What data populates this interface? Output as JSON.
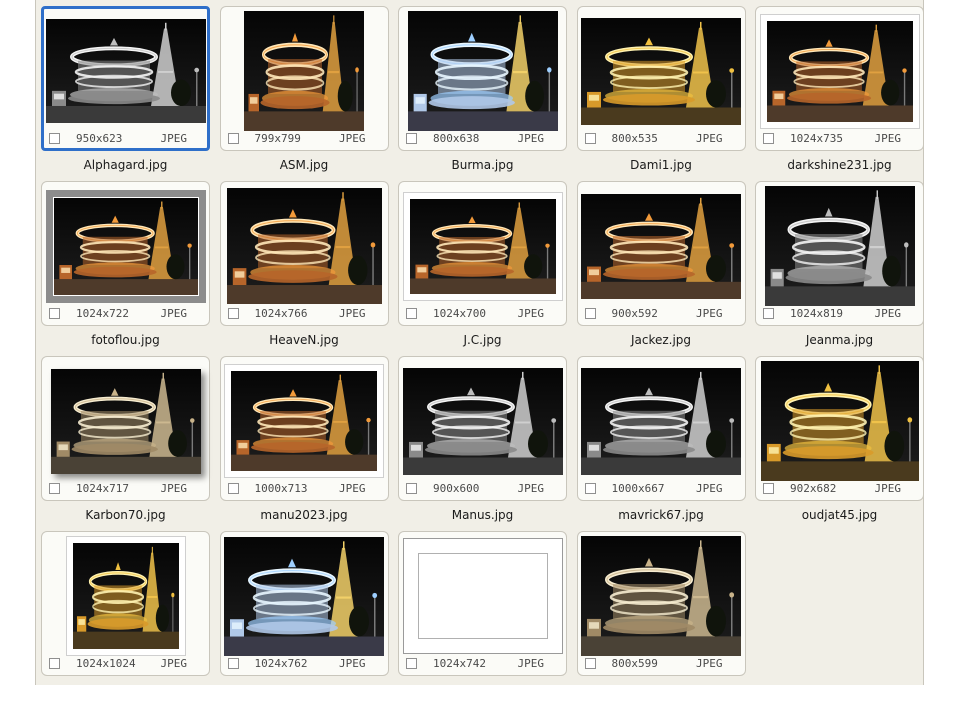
{
  "accent_color": "#2f6fc9",
  "items": [
    {
      "name": "Alphagard.jpg",
      "dims": "950x623",
      "type": "JPEG",
      "selected": true,
      "variant": "mono",
      "frame": "none",
      "tw": 160,
      "th": 104
    },
    {
      "name": "ASM.jpg",
      "dims": "799x799",
      "type": "JPEG",
      "selected": false,
      "variant": "warm",
      "frame": "none",
      "tw": 120,
      "th": 120
    },
    {
      "name": "Burma.jpg",
      "dims": "800x638",
      "type": "JPEG",
      "selected": false,
      "variant": "blue",
      "frame": "none",
      "tw": 150,
      "th": 120
    },
    {
      "name": "Dami1.jpg",
      "dims": "800x535",
      "type": "JPEG",
      "selected": false,
      "variant": "gold",
      "frame": "none",
      "tw": 160,
      "th": 107
    },
    {
      "name": "darkshine231.jpg",
      "dims": "1024x735",
      "type": "JPEG",
      "selected": false,
      "variant": "warm",
      "frame": "white",
      "tw": 160,
      "th": 115
    },
    {
      "name": "fotoflou.jpg",
      "dims": "1024x722",
      "type": "JPEG",
      "selected": false,
      "variant": "warm",
      "frame": "gray",
      "tw": 160,
      "th": 113
    },
    {
      "name": "HeaveN.jpg",
      "dims": "1024x766",
      "type": "JPEG",
      "selected": false,
      "variant": "warm",
      "frame": "none",
      "tw": 155,
      "th": 116
    },
    {
      "name": "J.C.jpg",
      "dims": "1024x700",
      "type": "JPEG",
      "selected": false,
      "variant": "warm",
      "frame": "white",
      "tw": 160,
      "th": 109
    },
    {
      "name": "Jackez.jpg",
      "dims": "900x592",
      "type": "JPEG",
      "selected": false,
      "variant": "warm",
      "frame": "none",
      "tw": 160,
      "th": 105
    },
    {
      "name": "Jeanma.jpg",
      "dims": "1024x819",
      "type": "JPEG",
      "selected": false,
      "variant": "mono",
      "frame": "none",
      "tw": 150,
      "th": 120
    },
    {
      "name": "Karbon70.jpg",
      "dims": "1024x717",
      "type": "JPEG",
      "selected": false,
      "variant": "sepia",
      "frame": "shadow",
      "tw": 150,
      "th": 105
    },
    {
      "name": "manu2023.jpg",
      "dims": "1000x713",
      "type": "JPEG",
      "selected": false,
      "variant": "warm",
      "frame": "white",
      "tw": 160,
      "th": 114
    },
    {
      "name": "Manus.jpg",
      "dims": "900x600",
      "type": "JPEG",
      "selected": false,
      "variant": "mono",
      "frame": "none",
      "tw": 160,
      "th": 107
    },
    {
      "name": "mavrick67.jpg",
      "dims": "1000x667",
      "type": "JPEG",
      "selected": false,
      "variant": "mono",
      "frame": "none",
      "tw": 160,
      "th": 107
    },
    {
      "name": "oudjat45.jpg",
      "dims": "902x682",
      "type": "JPEG",
      "selected": false,
      "variant": "gold",
      "frame": "none",
      "tw": 158,
      "th": 120
    },
    {
      "name": "",
      "dims": "1024x1024",
      "type": "JPEG",
      "selected": false,
      "variant": "gold",
      "frame": "white",
      "tw": 120,
      "th": 120
    },
    {
      "name": "",
      "dims": "1024x762",
      "type": "JPEG",
      "selected": false,
      "variant": "blue",
      "frame": "none",
      "tw": 160,
      "th": 119
    },
    {
      "name": "",
      "dims": "1024x742",
      "type": "JPEG",
      "selected": false,
      "variant": "blank",
      "frame": "blank",
      "tw": 160,
      "th": 116
    },
    {
      "name": "",
      "dims": "800x599",
      "type": "JPEG",
      "selected": false,
      "variant": "sepia",
      "frame": "none",
      "tw": 160,
      "th": 120
    }
  ]
}
